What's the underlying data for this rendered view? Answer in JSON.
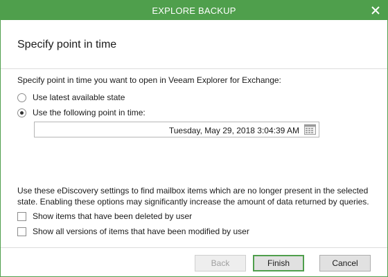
{
  "window": {
    "title": "EXPLORE BACKUP"
  },
  "header": {
    "title": "Specify point in time"
  },
  "content": {
    "instruction": "Specify point in time you want to open in Veeam Explorer for Exchange:",
    "options": [
      {
        "label": "Use latest available state",
        "selected": false
      },
      {
        "label": "Use the following point in time:",
        "selected": true
      }
    ],
    "datetime_value": "Tuesday, May 29, 2018 3:04:39 AM",
    "ediscovery_text": "Use these eDiscovery settings to find mailbox items which are no longer present in the selected state. Enabling these options may significantly increase the amount of data returned by queries.",
    "checkboxes": [
      {
        "label": "Show items that have been deleted by user",
        "checked": false
      },
      {
        "label": "Show all versions of items that have been modified by user",
        "checked": false
      }
    ]
  },
  "footer": {
    "back_label": "Back",
    "finish_label": "Finish",
    "cancel_label": "Cancel"
  },
  "icons": {
    "close": "close-icon",
    "calendar": "calendar-icon"
  },
  "colors": {
    "accent": "#4f9f4c"
  }
}
